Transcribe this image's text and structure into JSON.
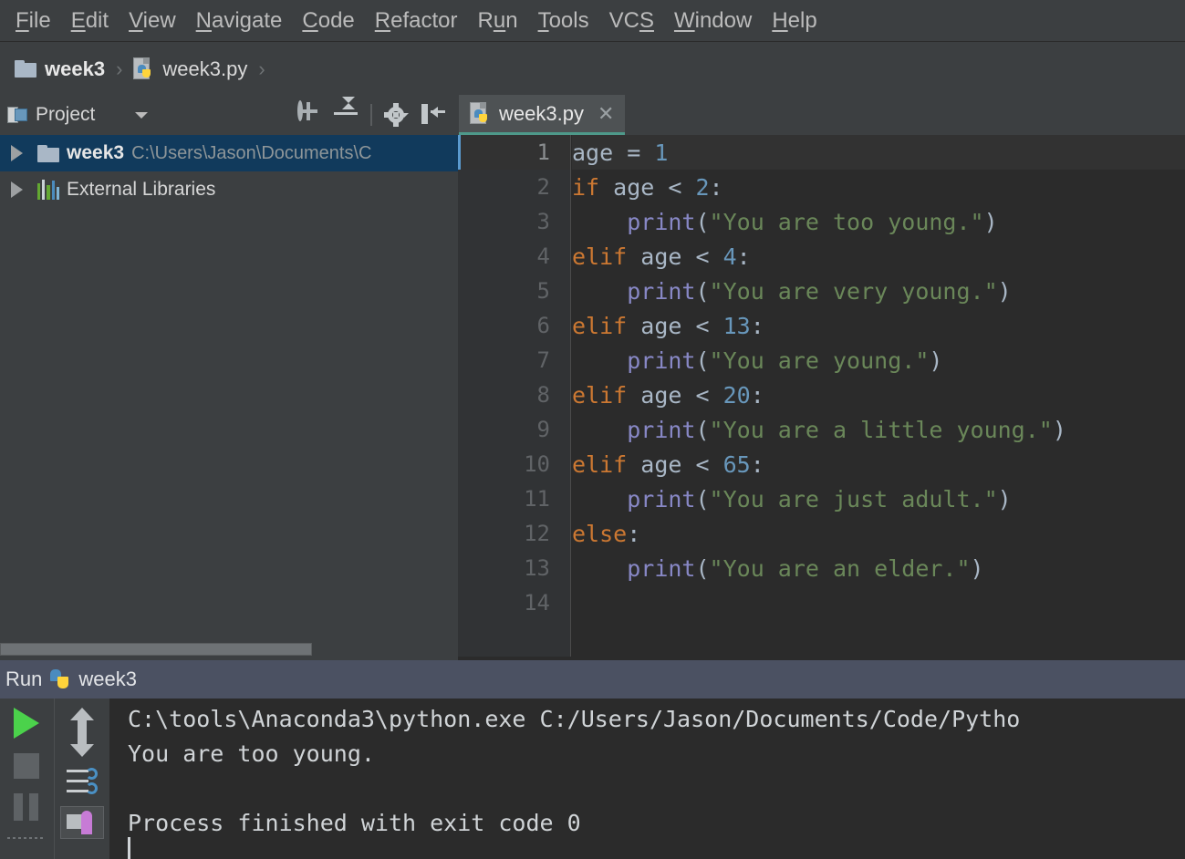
{
  "menubar": {
    "items": [
      {
        "label": "File",
        "mnemonic": "F"
      },
      {
        "label": "Edit",
        "mnemonic": "E"
      },
      {
        "label": "View",
        "mnemonic": "V"
      },
      {
        "label": "Navigate",
        "mnemonic": "N"
      },
      {
        "label": "Code",
        "mnemonic": "C"
      },
      {
        "label": "Refactor",
        "mnemonic": "R"
      },
      {
        "label": "Run",
        "mnemonic": "u"
      },
      {
        "label": "Tools",
        "mnemonic": "T"
      },
      {
        "label": "VCS",
        "mnemonic": "S"
      },
      {
        "label": "Window",
        "mnemonic": "W"
      },
      {
        "label": "Help",
        "mnemonic": "H"
      }
    ]
  },
  "breadcrumb": {
    "folder": "week3",
    "file": "week3.py",
    "separator": "›",
    "folder_icon": "folder-icon",
    "file_icon": "python-file-icon"
  },
  "project_panel": {
    "title": "Project",
    "title_icon": "project-window-icon",
    "dropdown_icon": "chevron-down-icon",
    "toolbar_icons": [
      "locate-icon",
      "collapse-all-icon",
      "gear-icon",
      "hide-panel-icon"
    ],
    "tree": [
      {
        "label": "week3",
        "path": "C:\\Users\\Jason\\Documents\\C",
        "icon": "folder-icon",
        "expander": "collapsed-arrow-icon",
        "selected": true
      },
      {
        "label": "External Libraries",
        "path": "",
        "icon": "libraries-icon",
        "expander": "collapsed-arrow-icon",
        "selected": false
      }
    ]
  },
  "editor": {
    "tab": {
      "label": "week3.py",
      "icon": "python-file-icon",
      "close_icon": "close-icon",
      "active": true
    },
    "caret_line": 1,
    "lines": [
      {
        "n": "1",
        "tokens": [
          {
            "t": "age ",
            "c": "pl"
          },
          {
            "t": "= ",
            "c": "pl"
          },
          {
            "t": "1",
            "c": "num"
          }
        ]
      },
      {
        "n": "2",
        "tokens": [
          {
            "t": "if ",
            "c": "kw"
          },
          {
            "t": "age < ",
            "c": "pl"
          },
          {
            "t": "2",
            "c": "num"
          },
          {
            "t": ":",
            "c": "pl"
          }
        ]
      },
      {
        "n": "3",
        "tokens": [
          {
            "t": "    ",
            "c": "pl"
          },
          {
            "t": "print",
            "c": "fn"
          },
          {
            "t": "(",
            "c": "pl"
          },
          {
            "t": "\"You are too young.\"",
            "c": "str"
          },
          {
            "t": ")",
            "c": "pl"
          }
        ]
      },
      {
        "n": "4",
        "tokens": [
          {
            "t": "elif ",
            "c": "kw"
          },
          {
            "t": "age < ",
            "c": "pl"
          },
          {
            "t": "4",
            "c": "num"
          },
          {
            "t": ":",
            "c": "pl"
          }
        ]
      },
      {
        "n": "5",
        "tokens": [
          {
            "t": "    ",
            "c": "pl"
          },
          {
            "t": "print",
            "c": "fn"
          },
          {
            "t": "(",
            "c": "pl"
          },
          {
            "t": "\"You are very young.\"",
            "c": "str"
          },
          {
            "t": ")",
            "c": "pl"
          }
        ]
      },
      {
        "n": "6",
        "tokens": [
          {
            "t": "elif ",
            "c": "kw"
          },
          {
            "t": "age < ",
            "c": "pl"
          },
          {
            "t": "13",
            "c": "num"
          },
          {
            "t": ":",
            "c": "pl"
          }
        ]
      },
      {
        "n": "7",
        "tokens": [
          {
            "t": "    ",
            "c": "pl"
          },
          {
            "t": "print",
            "c": "fn"
          },
          {
            "t": "(",
            "c": "pl"
          },
          {
            "t": "\"You are young.\"",
            "c": "str"
          },
          {
            "t": ")",
            "c": "pl"
          }
        ]
      },
      {
        "n": "8",
        "tokens": [
          {
            "t": "elif ",
            "c": "kw"
          },
          {
            "t": "age < ",
            "c": "pl"
          },
          {
            "t": "20",
            "c": "num"
          },
          {
            "t": ":",
            "c": "pl"
          }
        ]
      },
      {
        "n": "9",
        "tokens": [
          {
            "t": "    ",
            "c": "pl"
          },
          {
            "t": "print",
            "c": "fn"
          },
          {
            "t": "(",
            "c": "pl"
          },
          {
            "t": "\"You are a little young.\"",
            "c": "str"
          },
          {
            "t": ")",
            "c": "pl"
          }
        ]
      },
      {
        "n": "10",
        "tokens": [
          {
            "t": "elif ",
            "c": "kw"
          },
          {
            "t": "age < ",
            "c": "pl"
          },
          {
            "t": "65",
            "c": "num"
          },
          {
            "t": ":",
            "c": "pl"
          }
        ]
      },
      {
        "n": "11",
        "tokens": [
          {
            "t": "    ",
            "c": "pl"
          },
          {
            "t": "print",
            "c": "fn"
          },
          {
            "t": "(",
            "c": "pl"
          },
          {
            "t": "\"You are just adult.\"",
            "c": "str"
          },
          {
            "t": ")",
            "c": "pl"
          }
        ]
      },
      {
        "n": "12",
        "tokens": [
          {
            "t": "else",
            "c": "kw"
          },
          {
            "t": ":",
            "c": "pl"
          }
        ]
      },
      {
        "n": "13",
        "tokens": [
          {
            "t": "    ",
            "c": "pl"
          },
          {
            "t": "print",
            "c": "fn"
          },
          {
            "t": "(",
            "c": "pl"
          },
          {
            "t": "\"You are an elder.\"",
            "c": "str"
          },
          {
            "t": ")",
            "c": "pl"
          }
        ]
      },
      {
        "n": "14",
        "tokens": []
      }
    ]
  },
  "run_panel": {
    "header_label": "Run",
    "config_name": "week3",
    "config_icon": "python-icon",
    "toolbar_icons": [
      "rerun-play-icon",
      "stop-icon",
      "pause-icon",
      "scroll-up-icon",
      "scroll-down-icon",
      "soft-wrap-icon",
      "print-icon"
    ],
    "console_lines": [
      "C:\\tools\\Anaconda3\\python.exe C:/Users/Jason/Documents/Code/Pytho",
      "You are too young.",
      "",
      "Process finished with exit code 0"
    ]
  },
  "colors": {
    "chrome_bg": "#3C3F41",
    "editor_bg": "#2B2B2B",
    "gutter_bg": "#313335",
    "selection_blue": "#113A5C",
    "run_header_bg": "#4B5162",
    "tab_underline": "#4E998A",
    "keyword": "#CC7832",
    "number": "#6897BB",
    "string": "#6A8759",
    "function": "#8888C6",
    "identifier": "#A9B7C6",
    "play_green": "#4BD24B"
  }
}
